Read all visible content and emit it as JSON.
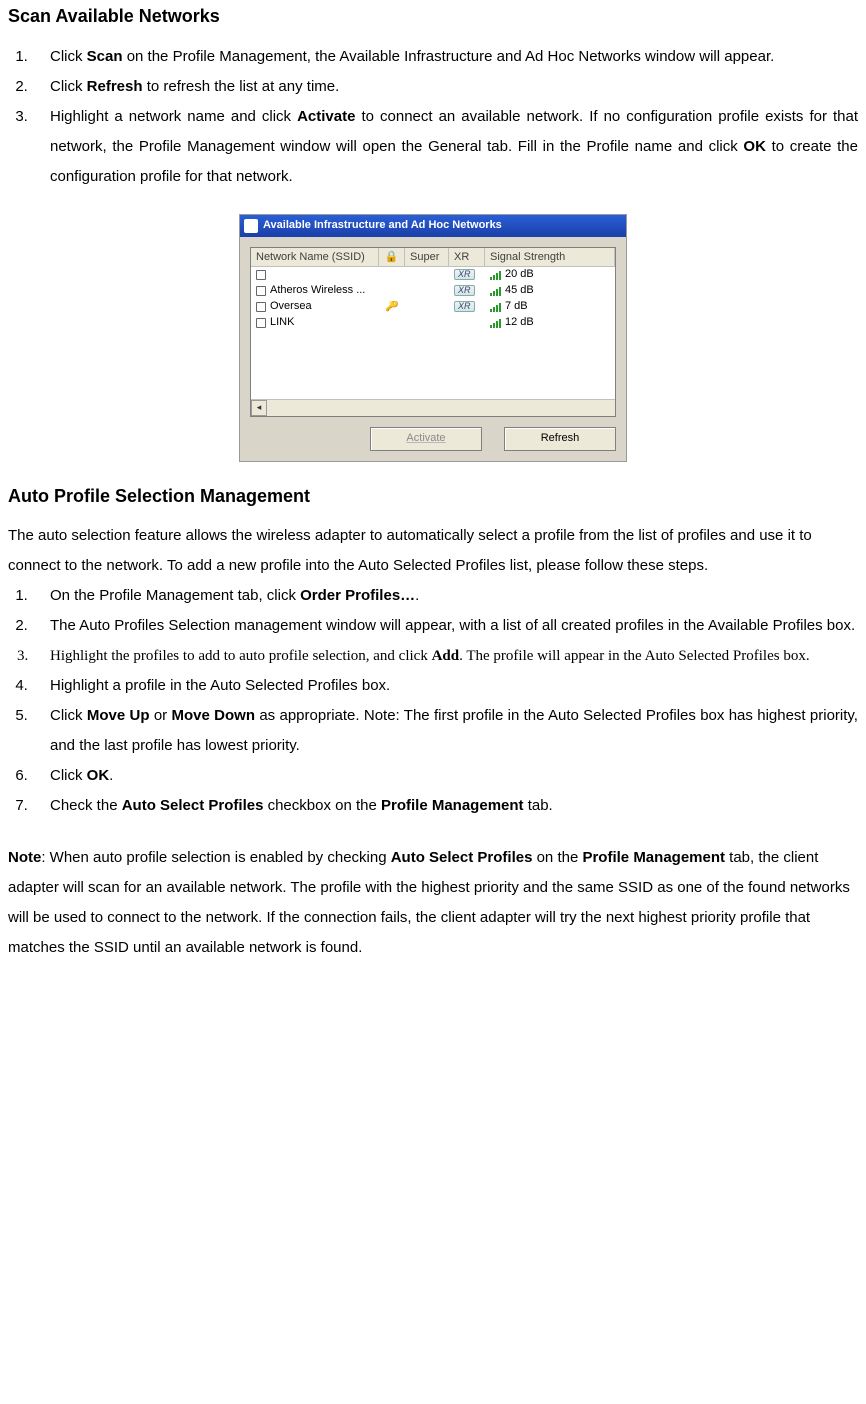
{
  "section1_heading": "Scan Available Networks",
  "steps1": [
    {
      "pre": "Click ",
      "b1": "Scan",
      "post": " on the Profile Management, the Available Infrastructure and Ad Hoc Networks window will appear."
    },
    {
      "pre": "Click ",
      "b1": "Refresh",
      "post": " to refresh the list at any time."
    },
    {
      "pre": "Highlight a network name and click ",
      "b1": "Activate",
      "mid": " to connect an available network. If no configuration profile exists for that network, the Profile Management window will open the General tab. Fill in the Profile name and click ",
      "b2": "OK",
      "post": " to create the configuration profile for that network."
    }
  ],
  "dialog": {
    "title": "Available Infrastructure and Ad Hoc Networks",
    "columns": {
      "ssid": "Network Name (SSID)",
      "lock_icon": "🔒",
      "super": "Super",
      "xr": "XR",
      "signal": "Signal Strength"
    },
    "rows": [
      {
        "ssid": "",
        "lock": "",
        "xr": "XR",
        "signal": "20 dB"
      },
      {
        "ssid": "Atheros Wireless ...",
        "lock": "",
        "xr": "XR",
        "signal": "45 dB"
      },
      {
        "ssid": "Oversea",
        "lock": "🔑",
        "xr": "XR",
        "signal": "7 dB"
      },
      {
        "ssid": "LINK",
        "lock": "",
        "xr": "",
        "signal": "12 dB"
      }
    ],
    "buttons": {
      "activate": "Activate",
      "refresh": "Refresh"
    }
  },
  "section2_heading": "Auto Profile Selection Management",
  "intro2": "The auto selection feature allows the wireless adapter to automatically select a profile from the list of profiles and use it to connect to the network. To add a new profile into the Auto Selected Profiles list, please follow these steps.",
  "steps2": [
    {
      "pre": "On the Profile Management tab, click ",
      "b1": "Order Profiles…",
      "post": "."
    },
    {
      "pre": "The Auto Profiles Selection management window will appear, with a list of all created profiles in the Available Profiles box."
    },
    {
      "serif": true,
      "pre": "Highlight the profiles to add to auto profile selection, and click ",
      "b1": "Add",
      "post": ". The profile will appear in the Auto Selected Profiles box."
    },
    {
      "pre": "Highlight a profile in the Auto Selected Profiles box."
    },
    {
      "pre": "Click ",
      "b1": "Move Up",
      "mid": " or ",
      "b2": "Move Down",
      "post": " as appropriate. Note: The first profile in the Auto Selected Profiles box has highest priority, and the last profile has lowest priority."
    },
    {
      "pre": "Click ",
      "b1": "OK",
      "post": "."
    },
    {
      "pre": "Check the ",
      "b1": "Auto Select Profiles",
      "mid": " checkbox on the ",
      "b2": "Profile Management",
      "post": " tab."
    }
  ],
  "note": {
    "label": "Note",
    "t1": ": When auto profile selection is enabled by checking ",
    "b1": "Auto Select Profiles",
    "t2": " on the ",
    "b2": "Profile Management",
    "t3": " tab, the client adapter will scan for an available network. The profile with the highest priority and the same SSID as one of the found networks will be used to connect to the network. If the connection fails, the client adapter will try the next highest priority profile that matches the SSID until an available network is found."
  }
}
